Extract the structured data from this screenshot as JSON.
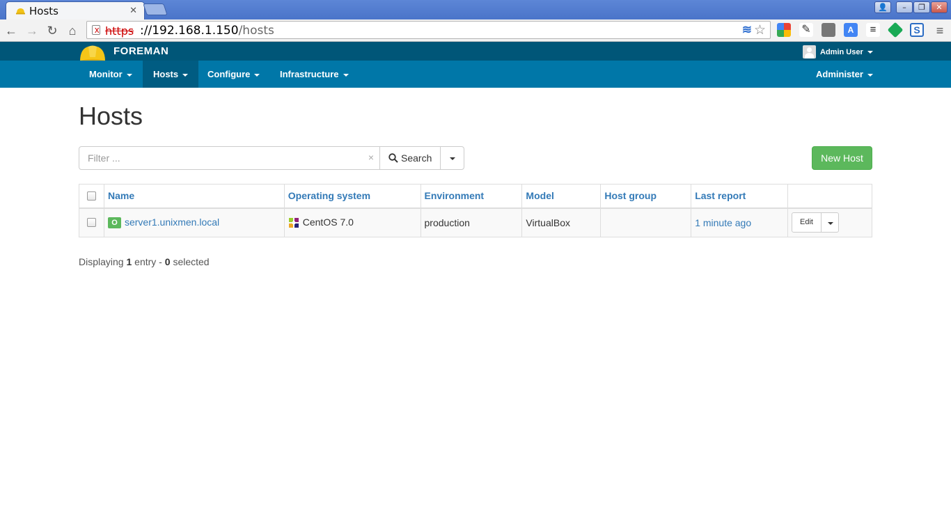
{
  "browser": {
    "tab_title": "Hosts",
    "url_scheme": "https",
    "url_host": "192.168.1.150",
    "url_path": "/hosts"
  },
  "app": {
    "brand": "FOREMAN",
    "user_name": "Admin User",
    "nav": {
      "monitor": "Monitor",
      "hosts": "Hosts",
      "configure": "Configure",
      "infrastructure": "Infrastructure",
      "administer": "Administer"
    }
  },
  "page": {
    "title": "Hosts",
    "filter_placeholder": "Filter ...",
    "search_label": "Search",
    "new_host_label": "New Host",
    "columns": {
      "name": "Name",
      "os": "Operating system",
      "environment": "Environment",
      "model": "Model",
      "host_group": "Host group",
      "last_report": "Last report"
    },
    "rows": [
      {
        "status": "O",
        "name": "server1.unixmen.local",
        "os": "CentOS 7.0",
        "environment": "production",
        "model": "VirtualBox",
        "host_group": "",
        "last_report": "1 minute ago",
        "action": "Edit"
      }
    ],
    "summary": {
      "prefix": "Displaying",
      "count": "1",
      "middle": "entry -",
      "selected": "0",
      "suffix": "selected"
    }
  },
  "colors": {
    "header_dark": "#005678",
    "header_nav": "#0077a8",
    "link": "#337ab7",
    "success": "#5cb85c"
  }
}
